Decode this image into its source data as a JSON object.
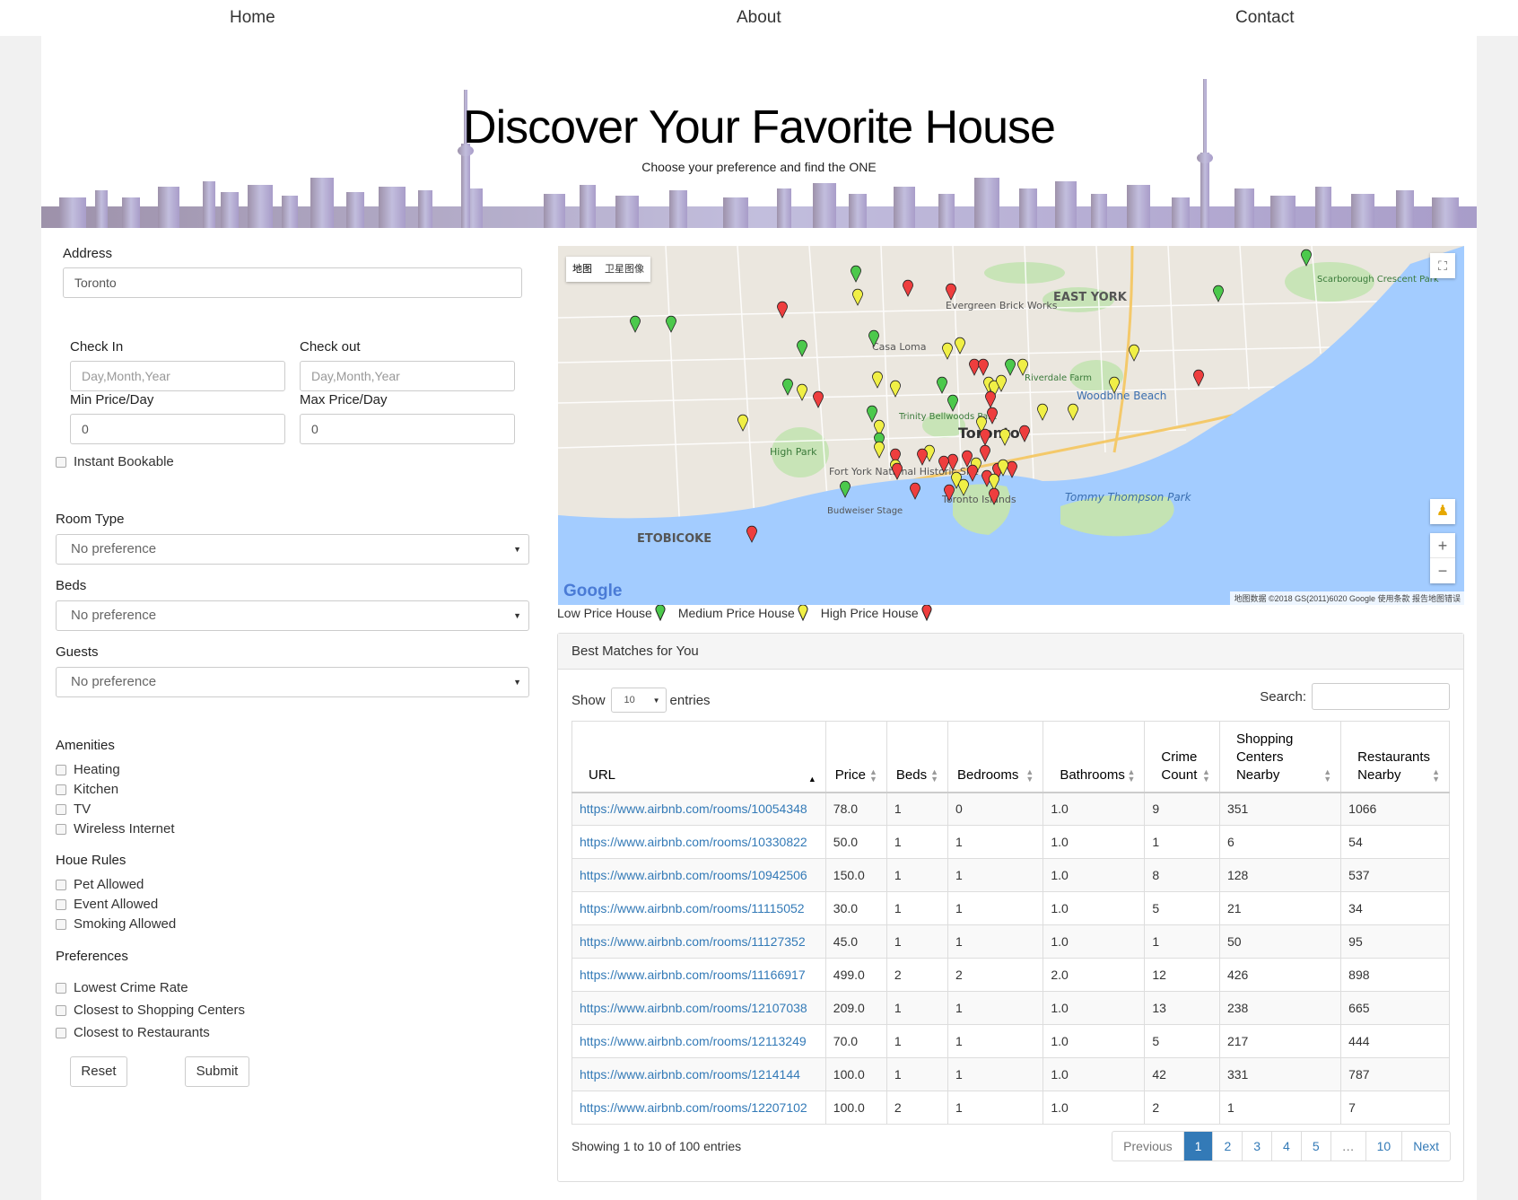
{
  "nav": {
    "home": "Home",
    "about": "About",
    "contact": "Contact"
  },
  "hero": {
    "title": "Discover Your Favorite House",
    "subtitle": "Choose your preference and find the ONE"
  },
  "form": {
    "address_label": "Address",
    "address_value": "Toronto",
    "checkin_label": "Check In",
    "checkin_placeholder": "Day,Month,Year",
    "checkout_label": "Check out",
    "checkout_placeholder": "Day,Month,Year",
    "min_price_label": "Min Price/Day",
    "min_price_value": "0",
    "max_price_label": "Max Price/Day",
    "max_price_value": "0",
    "instant_label": "Instant Bookable",
    "room_type_label": "Room Type",
    "room_type_value": "No preference",
    "beds_label": "Beds",
    "beds_value": "No preference",
    "guests_label": "Guests",
    "guests_value": "No preference",
    "amenities_label": "Amenities",
    "amenities": [
      "Heating",
      "Kitchen",
      "TV",
      "Wireless Internet"
    ],
    "rules_label": "Houe Rules",
    "rules": [
      "Pet Allowed",
      "Event Allowed",
      "Smoking Allowed"
    ],
    "prefs_label": "Preferences",
    "prefs": [
      "Lowest Crime Rate",
      "Closest to Shopping Centers",
      "Closest to Restaurants"
    ],
    "reset_label": "Reset",
    "submit_label": "Submit"
  },
  "map": {
    "tab_map": "地图",
    "tab_satellite": "卫星图像",
    "attribution": "地图数据 ©2018 GS(2011)6020 Google   使用条款   报告地图错误",
    "logo": "Google",
    "places": [
      "Toronto",
      "EAST YORK",
      "Tommy Thompson Park",
      "Woodbine Beach",
      "High Park",
      "Toronto Islands",
      "ETOBICOKE",
      "Casa Loma",
      "Evergreen Brick Works",
      "Scarborough Crescent Park",
      "Fort York National Historic Site",
      "Budweiser Stage",
      "Trinity Bellwoods Park",
      "Riverdale Farm"
    ],
    "colors": {
      "low": "#4cc94c",
      "medium": "#f0ef46",
      "high": "#ee3e3e",
      "water": "#a3ccff"
    }
  },
  "legend": {
    "low": "Low Price House",
    "medium": "Medium Price House",
    "high": "High Price House"
  },
  "results": {
    "title": "Best Matches for You",
    "show_label": "Show",
    "page_size": "10",
    "entries_label": "entries",
    "search_label": "Search:",
    "columns": [
      "URL",
      "Price",
      "Beds",
      "Bedrooms",
      "Bathrooms",
      "Crime Count",
      "Shopping Centers Nearby",
      "Restaurants Nearby"
    ],
    "rows": [
      [
        "https://www.airbnb.com/rooms/10054348",
        "78.0",
        "1",
        "0",
        "1.0",
        "9",
        "351",
        "1066"
      ],
      [
        "https://www.airbnb.com/rooms/10330822",
        "50.0",
        "1",
        "1",
        "1.0",
        "1",
        "6",
        "54"
      ],
      [
        "https://www.airbnb.com/rooms/10942506",
        "150.0",
        "1",
        "1",
        "1.0",
        "8",
        "128",
        "537"
      ],
      [
        "https://www.airbnb.com/rooms/11115052",
        "30.0",
        "1",
        "1",
        "1.0",
        "5",
        "21",
        "34"
      ],
      [
        "https://www.airbnb.com/rooms/11127352",
        "45.0",
        "1",
        "1",
        "1.0",
        "1",
        "50",
        "95"
      ],
      [
        "https://www.airbnb.com/rooms/11166917",
        "499.0",
        "2",
        "2",
        "2.0",
        "12",
        "426",
        "898"
      ],
      [
        "https://www.airbnb.com/rooms/12107038",
        "209.0",
        "1",
        "1",
        "1.0",
        "13",
        "238",
        "665"
      ],
      [
        "https://www.airbnb.com/rooms/12113249",
        "70.0",
        "1",
        "1",
        "1.0",
        "5",
        "217",
        "444"
      ],
      [
        "https://www.airbnb.com/rooms/1214144",
        "100.0",
        "1",
        "1",
        "1.0",
        "42",
        "331",
        "787"
      ],
      [
        "https://www.airbnb.com/rooms/12207102",
        "100.0",
        "2",
        "1",
        "1.0",
        "2",
        "1",
        "7"
      ]
    ],
    "summary": "Showing 1 to 10 of 100 entries",
    "pagination": [
      "Previous",
      "1",
      "2",
      "3",
      "4",
      "5",
      "…",
      "10",
      "Next"
    ]
  }
}
